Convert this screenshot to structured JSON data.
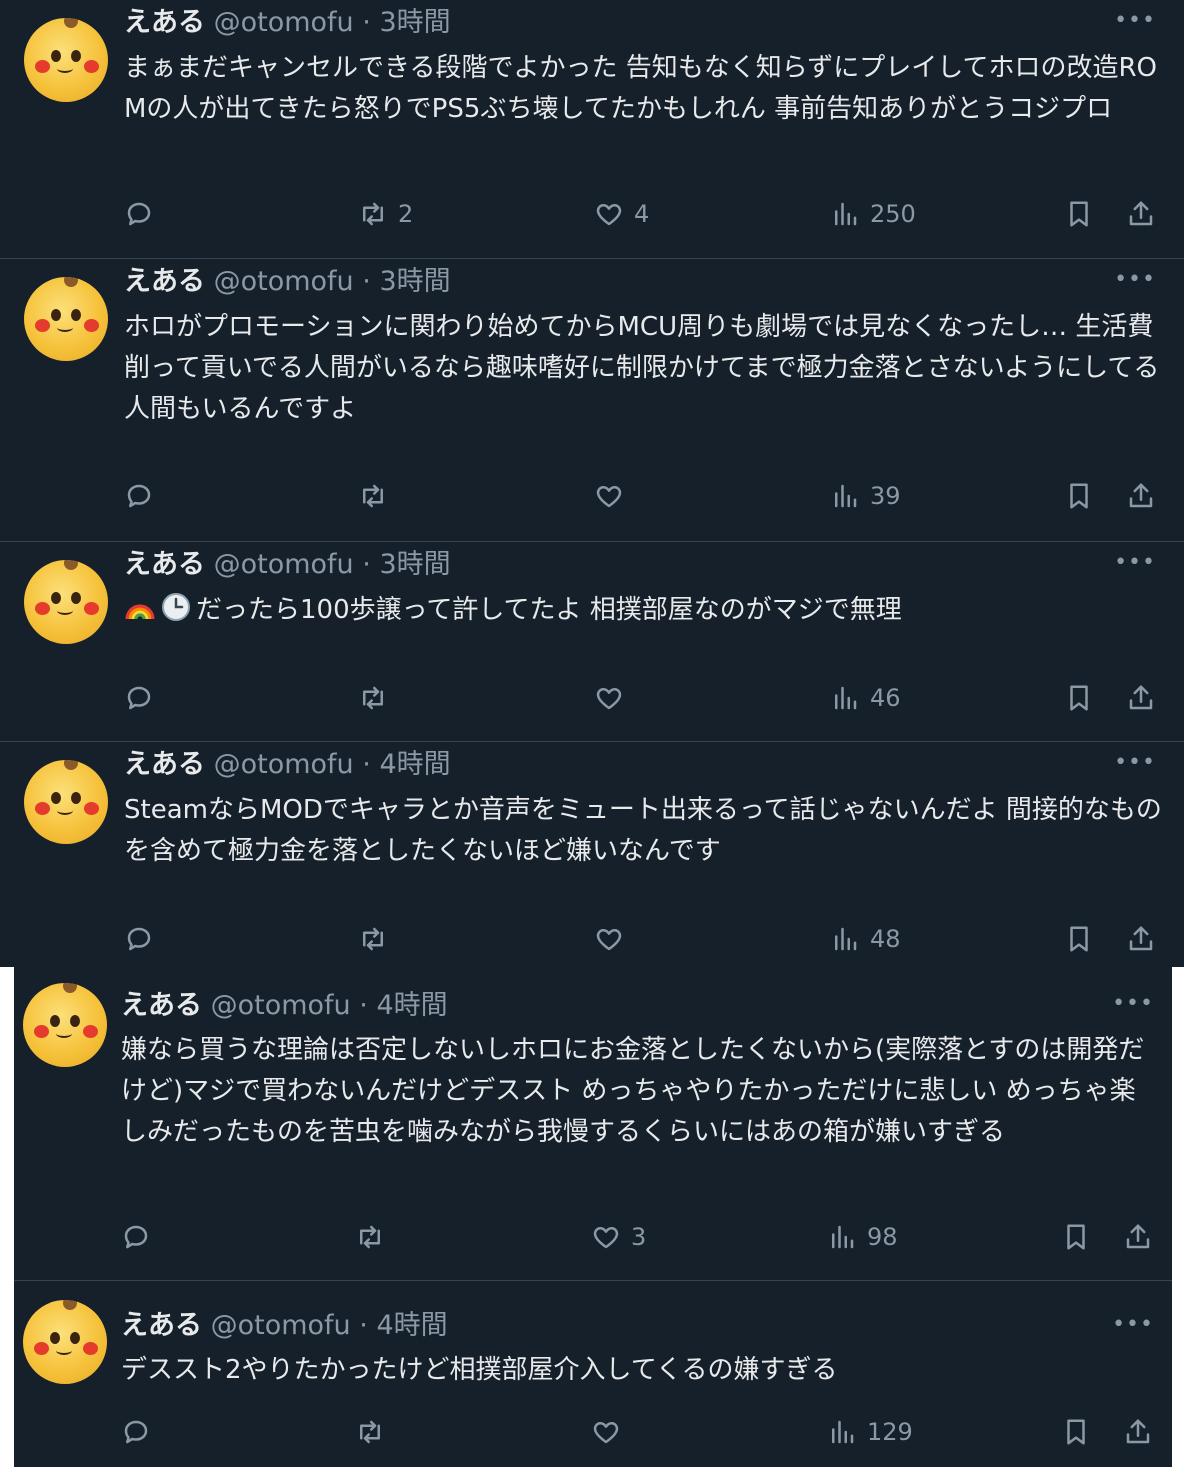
{
  "colors": {
    "background": "#15202b",
    "border": "#38444d",
    "text": "#e7e9ea",
    "muted": "#8b98a5"
  },
  "tweets": [
    {
      "name": "えある",
      "handle": "@otomofu",
      "sep": "·",
      "time": "3時間",
      "text": "まぁまだキャンセルできる段階でよかった 告知もなく知らずにプレイしてホロの改造ROMの人が出てきたら怒りでPS5ぶち壊してたかもしれん 事前告知ありがとうコジプロ",
      "retweets": "2",
      "likes": "4",
      "views": "250"
    },
    {
      "name": "えある",
      "handle": "@otomofu",
      "sep": "·",
      "time": "3時間",
      "text": "ホロがプロモーションに関わり始めてからMCU周りも劇場では見なくなったし… 生活費削って貢いでる人間がいるなら趣味嗜好に制限かけてまで極力金落とさないようにしてる人間もいるんですよ",
      "retweets": "",
      "likes": "",
      "views": "39"
    },
    {
      "name": "えある",
      "handle": "@otomofu",
      "sep": "·",
      "time": "3時間",
      "emoji": [
        "rainbow",
        "clock"
      ],
      "text": "だったら100歩譲って許してたよ 相撲部屋なのがマジで無理",
      "retweets": "",
      "likes": "",
      "views": "46"
    },
    {
      "name": "えある",
      "handle": "@otomofu",
      "sep": "·",
      "time": "4時間",
      "text": "SteamならMODでキャラとか音声をミュート出来るって話じゃないんだよ 間接的なものを含めて極力金を落としたくないほど嫌いなんです",
      "retweets": "",
      "likes": "",
      "views": "48"
    },
    {
      "name": "えある",
      "handle": "@otomofu",
      "sep": "·",
      "time": "4時間",
      "text": "嫌なら買うな理論は否定しないしホロにお金落としたくないから(実際落とすのは開発だけど)マジで買わないんだけどデススト めっちゃやりたかっただけに悲しい めっちゃ楽しみだったものを苦虫を噛みながら我慢するくらいにはあの箱が嫌いすぎる",
      "retweets": "",
      "likes": "3",
      "views": "98"
    },
    {
      "name": "えある",
      "handle": "@otomofu",
      "sep": "·",
      "time": "4時間",
      "text": "デススト2やりたかったけど相撲部屋介入してくるの嫌すぎる",
      "retweets": "",
      "likes": "",
      "views": "129"
    }
  ]
}
